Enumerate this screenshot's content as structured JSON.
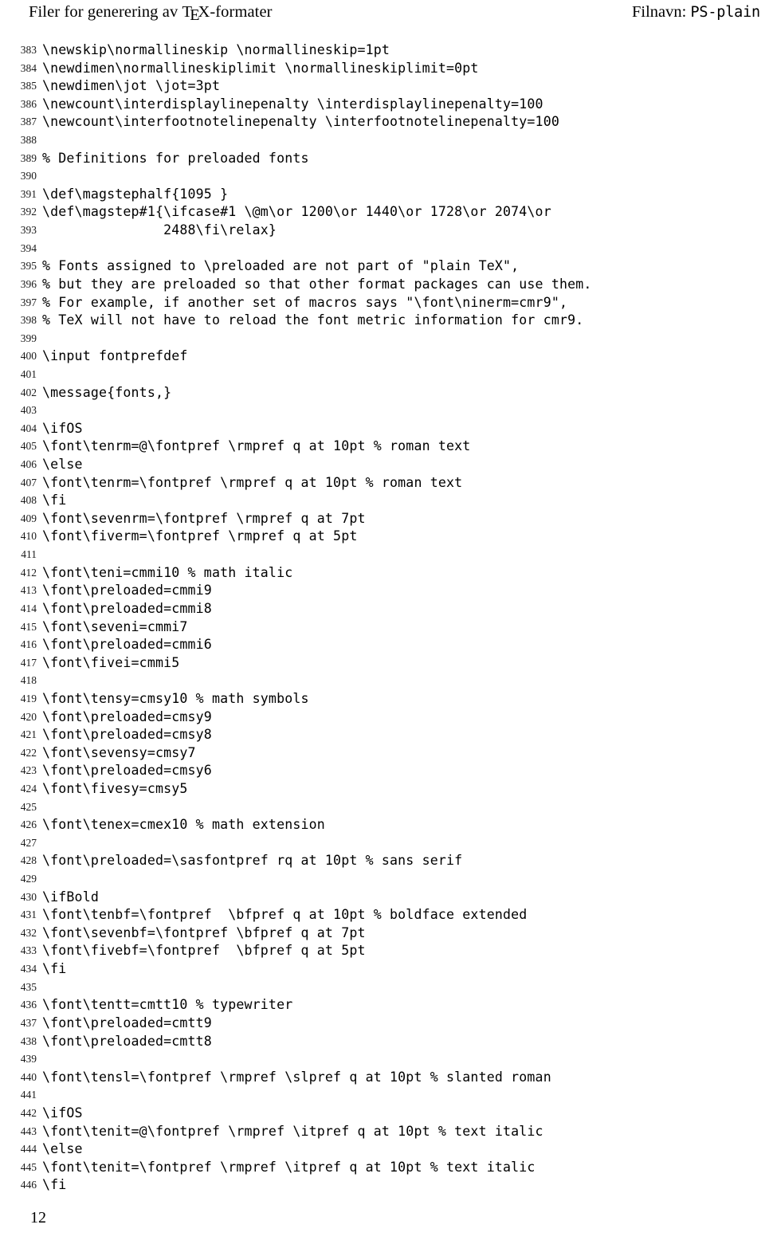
{
  "header": {
    "title_prefix": "Filer for generering av ",
    "title_tex": "TeX",
    "title_suffix": "-formater",
    "title_full": "Filer for generering av TeX-formater",
    "filename_label": "Filnavn: ",
    "filename_value": "PS-plain"
  },
  "footer": {
    "page_number": "12"
  },
  "listing": {
    "first_line_number": 383,
    "lines": [
      {
        "n": "383",
        "text": "\\newskip\\normallineskip \\normallineskip=1pt"
      },
      {
        "n": "384",
        "text": "\\newdimen\\normallineskiplimit \\normallineskiplimit=0pt"
      },
      {
        "n": "385",
        "text": "\\newdimen\\jot \\jot=3pt"
      },
      {
        "n": "386",
        "text": "\\newcount\\interdisplaylinepenalty \\interdisplaylinepenalty=100"
      },
      {
        "n": "387",
        "text": "\\newcount\\interfootnotelinepenalty \\interfootnotelinepenalty=100"
      },
      {
        "n": "388",
        "text": ""
      },
      {
        "n": "389",
        "text": "% Definitions for preloaded fonts"
      },
      {
        "n": "390",
        "text": ""
      },
      {
        "n": "391",
        "text": "\\def\\magstephalf{1095 }"
      },
      {
        "n": "392",
        "text": "\\def\\magstep#1{\\ifcase#1 \\@m\\or 1200\\or 1440\\or 1728\\or 2074\\or"
      },
      {
        "n": "393",
        "text": "               2488\\fi\\relax}"
      },
      {
        "n": "394",
        "text": ""
      },
      {
        "n": "395",
        "text": "% Fonts assigned to \\preloaded are not part of \"plain TeX\","
      },
      {
        "n": "396",
        "text": "% but they are preloaded so that other format packages can use them."
      },
      {
        "n": "397",
        "text": "% For example, if another set of macros says \"\\font\\ninerm=cmr9\","
      },
      {
        "n": "398",
        "text": "% TeX will not have to reload the font metric information for cmr9."
      },
      {
        "n": "399",
        "text": ""
      },
      {
        "n": "400",
        "text": "\\input fontprefdef"
      },
      {
        "n": "401",
        "text": ""
      },
      {
        "n": "402",
        "text": "\\message{fonts,}"
      },
      {
        "n": "403",
        "text": ""
      },
      {
        "n": "404",
        "text": "\\ifOS"
      },
      {
        "n": "405",
        "text": "\\font\\tenrm=@\\fontpref \\rmpref q at 10pt % roman text"
      },
      {
        "n": "406",
        "text": "\\else"
      },
      {
        "n": "407",
        "text": "\\font\\tenrm=\\fontpref \\rmpref q at 10pt % roman text"
      },
      {
        "n": "408",
        "text": "\\fi"
      },
      {
        "n": "409",
        "text": "\\font\\sevenrm=\\fontpref \\rmpref q at 7pt"
      },
      {
        "n": "410",
        "text": "\\font\\fiverm=\\fontpref \\rmpref q at 5pt"
      },
      {
        "n": "411",
        "text": ""
      },
      {
        "n": "412",
        "text": "\\font\\teni=cmmi10 % math italic"
      },
      {
        "n": "413",
        "text": "\\font\\preloaded=cmmi9"
      },
      {
        "n": "414",
        "text": "\\font\\preloaded=cmmi8"
      },
      {
        "n": "415",
        "text": "\\font\\seveni=cmmi7"
      },
      {
        "n": "416",
        "text": "\\font\\preloaded=cmmi6"
      },
      {
        "n": "417",
        "text": "\\font\\fivei=cmmi5"
      },
      {
        "n": "418",
        "text": ""
      },
      {
        "n": "419",
        "text": "\\font\\tensy=cmsy10 % math symbols"
      },
      {
        "n": "420",
        "text": "\\font\\preloaded=cmsy9"
      },
      {
        "n": "421",
        "text": "\\font\\preloaded=cmsy8"
      },
      {
        "n": "422",
        "text": "\\font\\sevensy=cmsy7"
      },
      {
        "n": "423",
        "text": "\\font\\preloaded=cmsy6"
      },
      {
        "n": "424",
        "text": "\\font\\fivesy=cmsy5"
      },
      {
        "n": "425",
        "text": ""
      },
      {
        "n": "426",
        "text": "\\font\\tenex=cmex10 % math extension"
      },
      {
        "n": "427",
        "text": ""
      },
      {
        "n": "428",
        "text": "\\font\\preloaded=\\sasfontpref rq at 10pt % sans serif"
      },
      {
        "n": "429",
        "text": ""
      },
      {
        "n": "430",
        "text": "\\ifBold"
      },
      {
        "n": "431",
        "text": "\\font\\tenbf=\\fontpref  \\bfpref q at 10pt % boldface extended"
      },
      {
        "n": "432",
        "text": "\\font\\sevenbf=\\fontpref \\bfpref q at 7pt"
      },
      {
        "n": "433",
        "text": "\\font\\fivebf=\\fontpref  \\bfpref q at 5pt"
      },
      {
        "n": "434",
        "text": "\\fi"
      },
      {
        "n": "435",
        "text": ""
      },
      {
        "n": "436",
        "text": "\\font\\tentt=cmtt10 % typewriter"
      },
      {
        "n": "437",
        "text": "\\font\\preloaded=cmtt9"
      },
      {
        "n": "438",
        "text": "\\font\\preloaded=cmtt8"
      },
      {
        "n": "439",
        "text": ""
      },
      {
        "n": "440",
        "text": "\\font\\tensl=\\fontpref \\rmpref \\slpref q at 10pt % slanted roman"
      },
      {
        "n": "441",
        "text": ""
      },
      {
        "n": "442",
        "text": "\\ifOS"
      },
      {
        "n": "443",
        "text": "\\font\\tenit=@\\fontpref \\rmpref \\itpref q at 10pt % text italic"
      },
      {
        "n": "444",
        "text": "\\else"
      },
      {
        "n": "445",
        "text": "\\font\\tenit=\\fontpref \\rmpref \\itpref q at 10pt % text italic"
      },
      {
        "n": "446",
        "text": "\\fi"
      }
    ]
  }
}
